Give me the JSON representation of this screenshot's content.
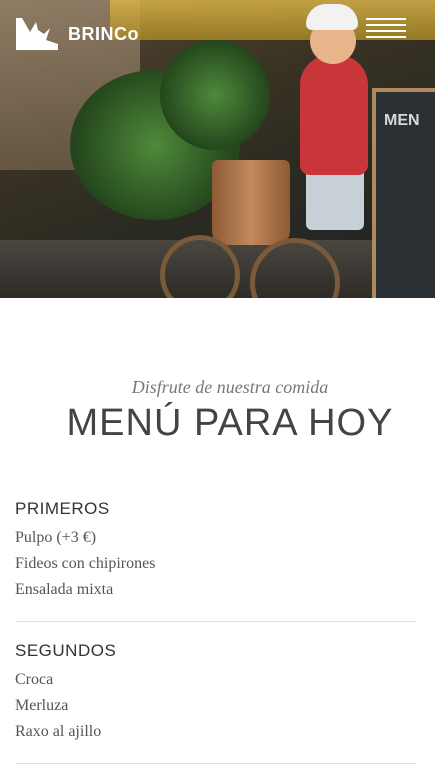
{
  "brand": {
    "name": "BRINCo"
  },
  "header": {
    "menu_icon": "hamburger-menu-icon"
  },
  "hero": {
    "board_text": "MEN"
  },
  "intro": {
    "subtitle": "Disfrute de nuestra comida",
    "title": "MENÚ PARA HOY"
  },
  "menu": {
    "sections": [
      {
        "title": "PRIMEROS",
        "items": [
          "Pulpo (+3 €)",
          "Fideos con chipirones",
          "Ensalada mixta"
        ]
      },
      {
        "title": "SEGUNDOS",
        "items": [
          "Croca",
          "Merluza",
          "Raxo al ajillo"
        ]
      }
    ]
  },
  "colors": {
    "text": "#444444",
    "muted": "#777777",
    "divider": "#e2e2e2"
  }
}
